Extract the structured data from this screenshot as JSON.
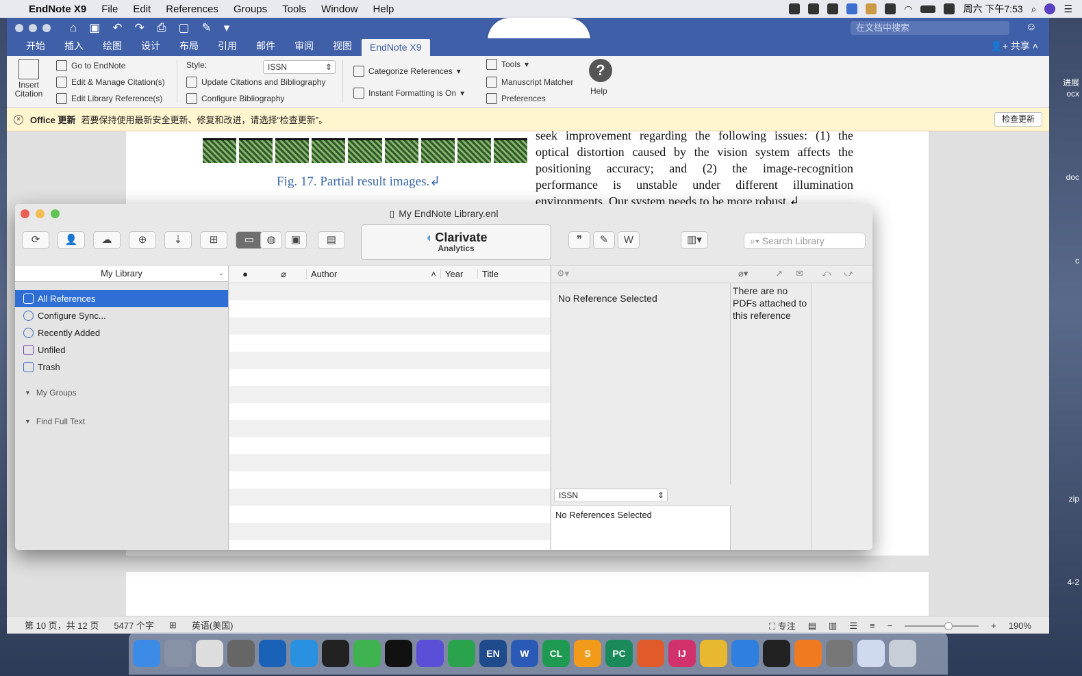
{
  "menubar": {
    "app": "EndNote X9",
    "items": [
      "File",
      "Edit",
      "References",
      "Groups",
      "Tools",
      "Window",
      "Help"
    ],
    "clock": "周六 下午7:53"
  },
  "word": {
    "search_placeholder": "在文档中搜索",
    "tabs": [
      "开始",
      "插入",
      "绘图",
      "设计",
      "布局",
      "引用",
      "邮件",
      "审阅",
      "视图",
      "EndNote X9"
    ],
    "share": "共享",
    "ribbon": {
      "insert_citation": "Insert Citation",
      "go_to_endnote": "Go to EndNote",
      "edit_manage": "Edit & Manage Citation(s)",
      "edit_library": "Edit Library Reference(s)",
      "style_label": "Style:",
      "style_value": "ISSN",
      "update_citations": "Update Citations and Bibliography",
      "configure_bibliography": "Configure Bibliography",
      "categorize": "Categorize References",
      "instant_formatting": "Instant Formatting is On",
      "tools": "Tools",
      "manuscript_matcher": "Manuscript Matcher",
      "preferences": "Preferences",
      "help": "Help"
    },
    "infobar": {
      "title": "Office 更新",
      "message": "若要保持使用最新安全更新、修复和改进，请选择“检查更新”。",
      "button": "检查更新"
    },
    "doc": {
      "fig_caption": "Fig. 17. Partial result images.↲",
      "para": "seek improvement regarding the following issues: (1) the optical distortion caused by the vision system affects the positioning accuracy; and (2) the image-recognition performance is unstable under different illumination environments. Our system needs to be more robust.↲"
    },
    "status": {
      "page": "第 10 页，共 12 页",
      "words": "5477 个字",
      "lang": "英语(美国)",
      "focus": "专注",
      "zoom": "190%"
    }
  },
  "endnote": {
    "title": "My EndNote Library.enl",
    "brand": "Clarivate",
    "brand_sub": "Analytics",
    "search_placeholder": "Search Library",
    "library_dropdown": "My Library",
    "groups": [
      {
        "label": "All References",
        "icon": "all-references-icon",
        "selected": true
      },
      {
        "label": "Configure Sync...",
        "icon": "sync-icon",
        "selected": false
      },
      {
        "label": "Recently Added",
        "icon": "recently-added-icon",
        "selected": false
      },
      {
        "label": "Unfiled",
        "icon": "unfiled-icon",
        "selected": false
      },
      {
        "label": "Trash",
        "icon": "trash-icon",
        "selected": false
      }
    ],
    "group_sections": [
      "My Groups",
      "Find Full Text"
    ],
    "columns": [
      "Author",
      "Year",
      "Title"
    ],
    "preview_message": "No Reference Selected",
    "pdf_message": "There are no PDFs attached to this reference",
    "style_value": "ISSN",
    "citation_message": "No References Selected"
  },
  "desktop_labels": [
    "进展",
    "ocx",
    "doc",
    "c",
    "zip",
    "4-2"
  ]
}
